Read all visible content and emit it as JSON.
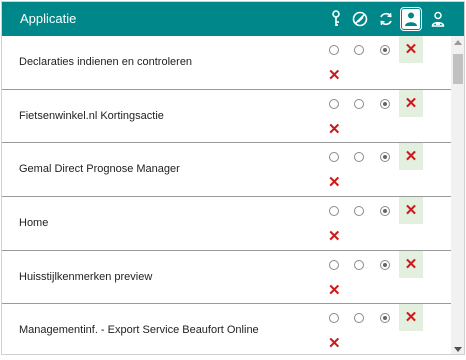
{
  "header": {
    "title": "Applicatie",
    "icons": [
      "key-icon",
      "blocked-icon",
      "cycle-icon",
      "person-icon",
      "manager-icon"
    ],
    "active_icon": "person-icon"
  },
  "rows": [
    {
      "label": "Declaraties indienen en controleren",
      "selected_option": 3
    },
    {
      "label": "Fietsenwinkel.nl Kortingsactie",
      "selected_option": 3
    },
    {
      "label": "Gemal Direct Prognose Manager",
      "selected_option": 3
    },
    {
      "label": "Home",
      "selected_option": 3
    },
    {
      "label": "Huisstijlkenmerken preview",
      "selected_option": 3
    },
    {
      "label": "Managementinf. - Export Service Beaufort Online",
      "selected_option": 3
    }
  ],
  "remove_symbol": "✕",
  "colors": {
    "header_bg": "#00878a",
    "remove_bg": "#e3f0e0",
    "remove_x": "#cc1a1a"
  }
}
